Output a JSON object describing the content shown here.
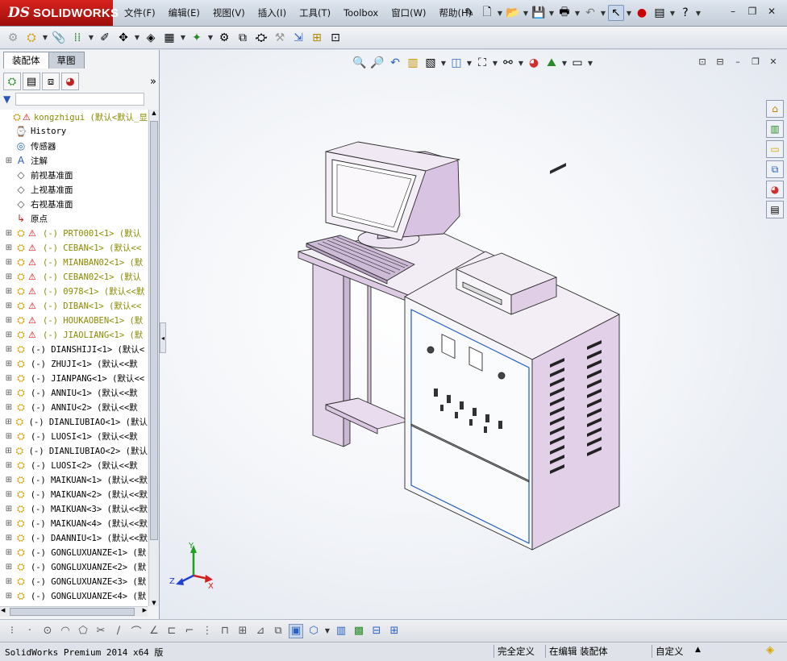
{
  "app": {
    "brand_prefix": "DS",
    "brand_name": "SOLIDWORKS"
  },
  "menu": [
    "文件(F)",
    "编辑(E)",
    "视图(V)",
    "插入(I)",
    "工具(T)",
    "Toolbox",
    "窗口(W)",
    "帮助(H)"
  ],
  "panel": {
    "tabs": [
      "装配体",
      "草图"
    ],
    "tree": [
      {
        "label": "kongzhigui  (默认<默认_显",
        "icon": "assembly-icon",
        "warn": true,
        "yellow": true,
        "exp": ""
      },
      {
        "label": "History",
        "icon": "history-icon",
        "warn": false,
        "yellow": false,
        "exp": ""
      },
      {
        "label": "传感器",
        "icon": "sensor-icon",
        "warn": false,
        "yellow": false,
        "exp": ""
      },
      {
        "label": "注解",
        "icon": "annotation-icon",
        "warn": false,
        "yellow": false,
        "exp": "+"
      },
      {
        "label": "前视基准面",
        "icon": "plane-icon",
        "warn": false,
        "yellow": false,
        "exp": ""
      },
      {
        "label": "上视基准面",
        "icon": "plane-icon",
        "warn": false,
        "yellow": false,
        "exp": ""
      },
      {
        "label": "右视基准面",
        "icon": "plane-icon",
        "warn": false,
        "yellow": false,
        "exp": ""
      },
      {
        "label": "原点",
        "icon": "origin-icon",
        "warn": false,
        "yellow": false,
        "exp": ""
      },
      {
        "label": "(-) PRT0001<1> (默认",
        "icon": "part-icon",
        "warn": true,
        "yellow": true,
        "exp": "+"
      },
      {
        "label": "(-) CEBAN<1> (默认<<",
        "icon": "part-icon",
        "warn": true,
        "yellow": true,
        "exp": "+"
      },
      {
        "label": "(-) MIANBAN02<1> (默",
        "icon": "part-icon",
        "warn": true,
        "yellow": true,
        "exp": "+"
      },
      {
        "label": "(-) CEBAN02<1> (默认",
        "icon": "part-icon",
        "warn": true,
        "yellow": true,
        "exp": "+"
      },
      {
        "label": "(-) 0978<1> (默认<<默",
        "icon": "part-icon",
        "warn": true,
        "yellow": true,
        "exp": "+"
      },
      {
        "label": "(-) DIBAN<1> (默认<<",
        "icon": "part-icon",
        "warn": true,
        "yellow": true,
        "exp": "+"
      },
      {
        "label": "(-) HOUKAOBEN<1> (默",
        "icon": "part-icon",
        "warn": true,
        "yellow": true,
        "exp": "+"
      },
      {
        "label": "(-) JIAOLIANG<1> (默",
        "icon": "part-icon",
        "warn": true,
        "yellow": true,
        "exp": "+"
      },
      {
        "label": "(-) DIANSHIJI<1> (默认<",
        "icon": "part-icon",
        "warn": false,
        "yellow": false,
        "exp": "+"
      },
      {
        "label": "(-) ZHUJI<1> (默认<<默",
        "icon": "part-icon",
        "warn": false,
        "yellow": false,
        "exp": "+"
      },
      {
        "label": "(-) JIANPANG<1> (默认<<",
        "icon": "part-icon",
        "warn": false,
        "yellow": false,
        "exp": "+"
      },
      {
        "label": "(-) ANNIU<1> (默认<<默",
        "icon": "part-icon",
        "warn": false,
        "yellow": false,
        "exp": "+"
      },
      {
        "label": "(-) ANNIU<2> (默认<<默",
        "icon": "part-icon",
        "warn": false,
        "yellow": false,
        "exp": "+"
      },
      {
        "label": "(-) DIANLIUBIAO<1> (默认",
        "icon": "part-icon",
        "warn": false,
        "yellow": false,
        "exp": "+"
      },
      {
        "label": "(-) LUOSI<1> (默认<<默",
        "icon": "part-icon",
        "warn": false,
        "yellow": false,
        "exp": "+"
      },
      {
        "label": "(-) DIANLIUBIAO<2> (默认",
        "icon": "part-icon",
        "warn": false,
        "yellow": false,
        "exp": "+"
      },
      {
        "label": "(-) LUOSI<2> (默认<<默",
        "icon": "part-icon",
        "warn": false,
        "yellow": false,
        "exp": "+"
      },
      {
        "label": "(-) MAIKUAN<1> (默认<<默",
        "icon": "part-icon",
        "warn": false,
        "yellow": false,
        "exp": "+"
      },
      {
        "label": "(-) MAIKUAN<2> (默认<<默",
        "icon": "part-icon",
        "warn": false,
        "yellow": false,
        "exp": "+"
      },
      {
        "label": "(-) MAIKUAN<3> (默认<<默",
        "icon": "part-icon",
        "warn": false,
        "yellow": false,
        "exp": "+"
      },
      {
        "label": "(-) MAIKUAN<4> (默认<<默",
        "icon": "part-icon",
        "warn": false,
        "yellow": false,
        "exp": "+"
      },
      {
        "label": "(-) DAANNIU<1> (默认<<默",
        "icon": "part-icon",
        "warn": false,
        "yellow": false,
        "exp": "+"
      },
      {
        "label": "(-) GONGLUXUANZE<1> (默",
        "icon": "part-icon",
        "warn": false,
        "yellow": false,
        "exp": "+"
      },
      {
        "label": "(-) GONGLUXUANZE<2> (默",
        "icon": "part-icon",
        "warn": false,
        "yellow": false,
        "exp": "+"
      },
      {
        "label": "(-) GONGLUXUANZE<3> (默",
        "icon": "part-icon",
        "warn": false,
        "yellow": false,
        "exp": "+"
      },
      {
        "label": "(-) GONGLUXUANZE<4> (默",
        "icon": "part-icon",
        "warn": false,
        "yellow": false,
        "exp": "+"
      }
    ]
  },
  "triad": {
    "x": "X",
    "y": "Y",
    "z": "Z"
  },
  "status": {
    "product": "SolidWorks Premium 2014 x64 版",
    "definition": "完全定义",
    "editing": "在编辑 装配体",
    "units": "自定义"
  },
  "colors": {
    "brand_red": "#c8181a",
    "part_face": "#dcc8e2",
    "part_edge": "#2a2a2a",
    "warn": "#d10000"
  }
}
